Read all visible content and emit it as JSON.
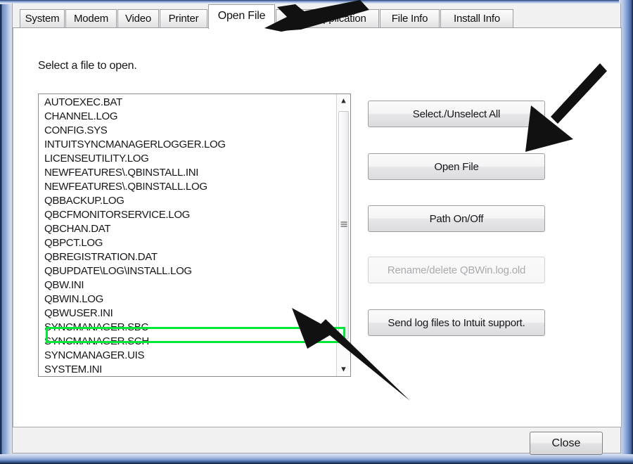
{
  "window": {
    "frame_color": "#5b7cb4",
    "dialog_bg": "#f1f1f2",
    "panel_bg": "#ffffff"
  },
  "tabs": [
    {
      "label": "System",
      "active": false
    },
    {
      "label": "Modem",
      "active": false
    },
    {
      "label": "Video",
      "active": false
    },
    {
      "label": "Printer",
      "active": false
    },
    {
      "label": "Open File",
      "active": true
    },
    {
      "label": "Open Application",
      "active": false
    },
    {
      "label": "File Info",
      "active": false
    },
    {
      "label": "Install Info",
      "active": false
    }
  ],
  "panel": {
    "instruction": "Select a file to open."
  },
  "file_list": {
    "selected": "QBWUSER.INI",
    "items": [
      "AUTOEXEC.BAT",
      "CHANNEL.LOG",
      "CONFIG.SYS",
      "INTUITSYNCMANAGERLOGGER.LOG",
      "LICENSEUTILITY.LOG",
      "NEWFEATURES\\.QBINSTALL.INI",
      "NEWFEATURES\\.QBINSTALL.LOG",
      "QBBACKUP.LOG",
      "QBCFMONITORSERVICE.LOG",
      "QBCHAN.DAT",
      "QBPCT.LOG",
      "QBREGISTRATION.DAT",
      "QBUPDATE\\LOG\\INSTALL.LOG",
      "QBW.INI",
      "QBWIN.LOG",
      "QBWUSER.INI",
      "SYNCMANAGER.SBC",
      "SYNCMANAGER.SCH",
      "SYNCMANAGER.UIS",
      "SYSTEM.INI"
    ]
  },
  "scrollbar": {
    "up_arrow": "▲",
    "down_arrow": "▼"
  },
  "buttons": {
    "select_all": "Select./Unselect All",
    "open_file": "Open File",
    "path_on_off": "Path On/Off",
    "rename_delete": "Rename/delete QBWin.log.old",
    "send_logs": "Send log files to Intuit support.",
    "close": "Close"
  },
  "annotations": {
    "highlight_color": "#00e838",
    "arrow_color": "#111111",
    "arrow_top_target": "Open File tab",
    "arrow_right_target": "Open File button",
    "arrow_bottom_target": "QBWUSER.INI list row"
  }
}
